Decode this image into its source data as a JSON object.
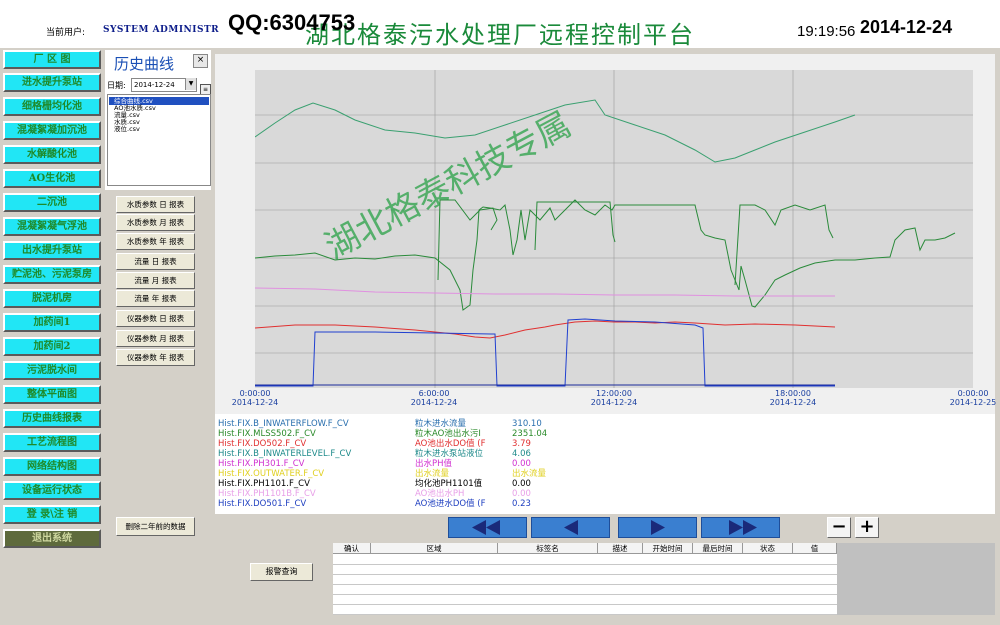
{
  "header": {
    "user_label": "当前用户:",
    "user_name": "SYSTEM ADMINISTR",
    "qq": "QQ:6304753",
    "title": "湖北格泰污水处理厂远程控制平台",
    "time": "19:19:56",
    "date": "2014-12-24"
  },
  "nav": [
    "厂 区 图",
    "进水提升泵站",
    "细格栅均化池",
    "混凝絮凝加沉池",
    "水解酸化池",
    "AO生化池",
    "二沉池",
    "混凝絮凝气浮池",
    "出水提升泵站",
    "贮泥池、污泥泵房",
    "脱泥机房",
    "加药间1",
    "加药间2",
    "污泥脱水间",
    "整体平面图",
    "历史曲线报表",
    "工艺流程图",
    "网络结构图",
    "设备运行状态",
    "登 录\\注 销",
    "退出系统"
  ],
  "history": {
    "title": "历史曲线",
    "close": "×",
    "date_label": "日期:",
    "date_value": "2014-12-24",
    "files": [
      "综合曲线.csv",
      "AO池水质.csv",
      "流量.csv",
      "水质.csv",
      "液位.csv"
    ]
  },
  "reports": [
    "水质参数 日 报表",
    "水质参数 月 报表",
    "水质参数 年 报表",
    "流量 日 报表",
    "流量 月 报表",
    "流量 年 报表",
    "仪器参数 日 报表",
    "仪器参数 月 报表",
    "仪器参数 年 报表"
  ],
  "delete_button": "删除二年前的数据",
  "alarm_button": "报警查询",
  "legend": [
    {
      "tag": "Hist.FIX.B_INWATERFLOW.F_CV",
      "desc": "粒木进水流量",
      "value": "310.10",
      "color": "#2a6fae"
    },
    {
      "tag": "Hist.FIX.MLSS502.F_CV",
      "desc": "粒木AO池出水污I",
      "value": "2351.04",
      "color": "#2a8a2a"
    },
    {
      "tag": "Hist.FIX.DO502.F_CV",
      "desc": "AO池出水DO值 (F",
      "value": "3.79",
      "color": "#e03030"
    },
    {
      "tag": "Hist.FIX.B_INWATERLEVEL.F_CV",
      "desc": "粒木进水泵站液位",
      "value": "4.06",
      "color": "#1e8a8a"
    },
    {
      "tag": "Hist.FIX.PH301.F_CV",
      "desc": "出水PH值",
      "value": "0.00",
      "color": "#d030d0"
    },
    {
      "tag": "Hist.FIX.OUTWATER.F_CV",
      "desc": "出水流量",
      "value": "出水流量",
      "color": "#e0d020"
    },
    {
      "tag": "Hist.FIX.PH1101.F_CV",
      "desc": "均化池PH1101值",
      "value": "0.00",
      "color": "#000000"
    },
    {
      "tag": "Hist.FIX.PH1101B.F_CV",
      "desc": "AO池出水PH",
      "value": "0.00",
      "color": "#e8a0e8"
    },
    {
      "tag": "Hist.FIX.DO501.F_CV",
      "desc": "AO池进水DO值 (F",
      "value": "0.23",
      "color": "#2040c0"
    }
  ],
  "x_ticks": [
    {
      "time": "0:00:00",
      "date": "2014-12-24"
    },
    {
      "time": "6:00:00",
      "date": "2014-12-24"
    },
    {
      "time": "12:00:00",
      "date": "2014-12-24"
    },
    {
      "time": "18:00:00",
      "date": "2014-12-24"
    },
    {
      "time": "0:00:00",
      "date": "2014-12-25"
    }
  ],
  "alarm_headers": [
    "确认",
    "区域",
    "标签名",
    "描述",
    "开始时间",
    "最后时间",
    "状态",
    "值"
  ],
  "watermark": "湖北格泰科技专属",
  "zoom_out": "−",
  "zoom_in": "+"
}
